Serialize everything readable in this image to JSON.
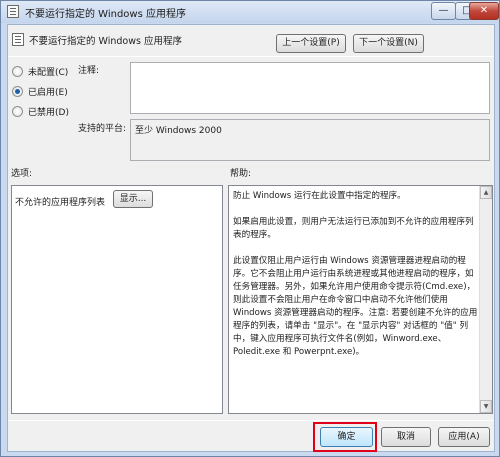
{
  "window": {
    "title": "不要运行指定的 Windows 应用程序",
    "minimize_glyph": "—",
    "maximize_glyph": "□",
    "close_glyph": "✕"
  },
  "header": {
    "title": "不要运行指定的 Windows 应用程序",
    "prev_button": "上一个设置(P)",
    "next_button": "下一个设置(N)"
  },
  "state": {
    "options": [
      {
        "label": "未配置(C)",
        "checked": false
      },
      {
        "label": "已启用(E)",
        "checked": true
      },
      {
        "label": "已禁用(D)",
        "checked": false
      }
    ]
  },
  "comment": {
    "label": "注释:",
    "value": ""
  },
  "platform": {
    "label": "支持的平台:",
    "value": "至少 Windows 2000"
  },
  "options_section": {
    "label": "选项:",
    "list_label": "不允许的应用程序列表",
    "show_button": "显示..."
  },
  "help_section": {
    "label": "帮助:",
    "paragraphs": [
      "防止 Windows 运行在此设置中指定的程序。",
      "如果启用此设置，则用户无法运行已添加到不允许的应用程序列表的程序。",
      "此设置仅阻止用户运行由 Windows 资源管理器进程启动的程序。它不会阻止用户运行由系统进程或其他进程启动的程序，如任务管理器。另外，如果允许用户使用命令提示符(Cmd.exe)，则此设置不会阻止用户在命令窗口中启动不允许他们使用 Windows 资源管理器启动的程序。注意: 若要创建不允许的应用程序的列表，请单击 \"显示\"。在 \"显示内容\" 对话框的 \"值\" 列中，键入应用程序可执行文件名(例如，Winword.exe、Poledit.exe 和 Powerpnt.exe)。"
    ]
  },
  "footer": {
    "ok_button": "确定",
    "cancel_button": "取消",
    "apply_button": "应用(A)"
  },
  "colors": {
    "highlight": "#e0001a",
    "radio_dot": "#1c5fa8"
  }
}
